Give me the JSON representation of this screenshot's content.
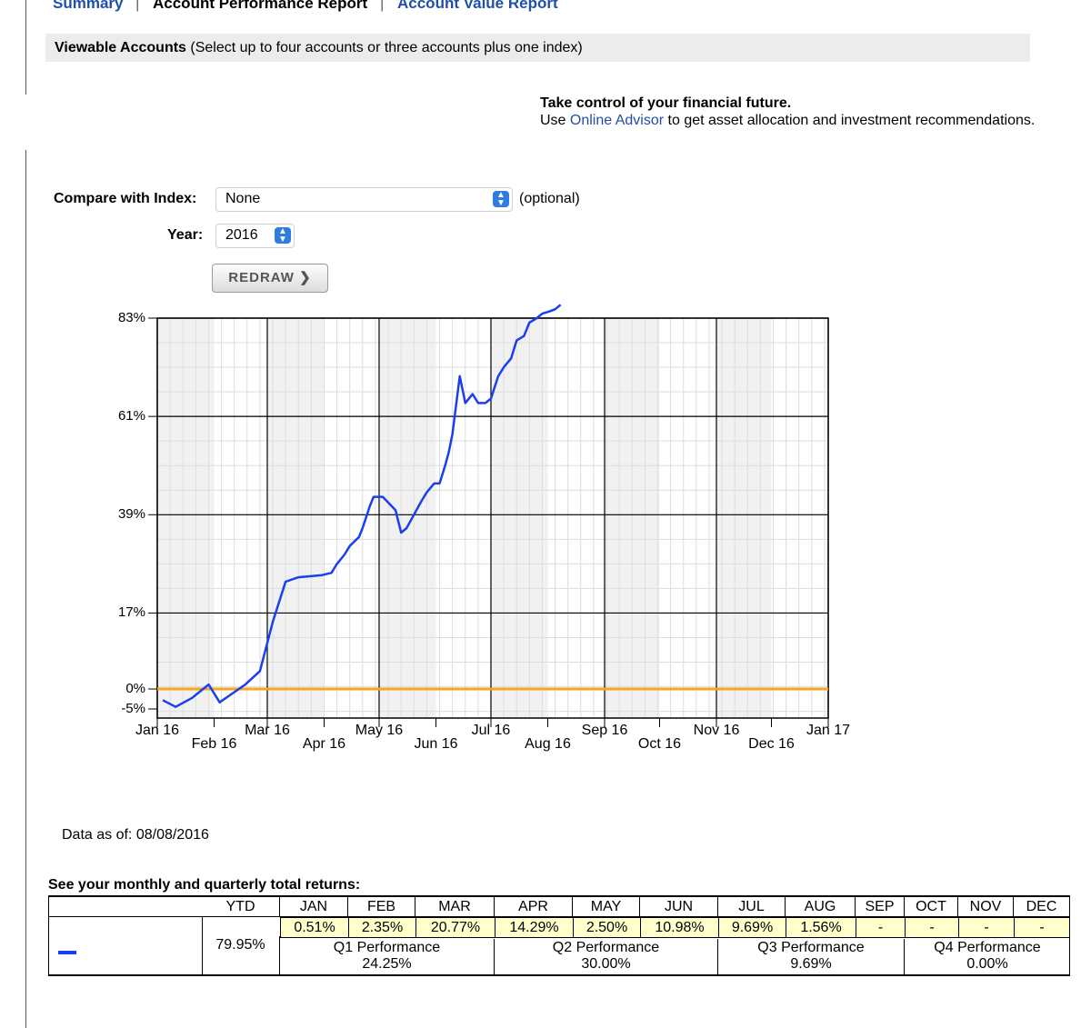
{
  "nav": {
    "summary": "Summary",
    "sep1": "|",
    "performance": "Account Performance Report",
    "sep2": "|",
    "value": "Account Value Report"
  },
  "viewable": {
    "title": "Viewable Accounts",
    "note": "(Select up to four accounts or three accounts plus one index)"
  },
  "promo": {
    "headline": "Take control of your financial future.",
    "pre": "Use ",
    "link": "Online Advisor",
    "post": " to get asset allocation and investment recommendations."
  },
  "form": {
    "index_label": "Compare with Index:",
    "index_value": "None",
    "optional": "(optional)",
    "year_label": "Year:",
    "year_value": "2016",
    "redraw": "REDRAW ❯"
  },
  "chart_data": {
    "type": "line",
    "y_ticks": [
      "83%",
      "61%",
      "39%",
      "17%",
      "0%",
      "-5%"
    ],
    "x_ticks_top": [
      "Jan 16",
      "Mar 16",
      "May 16",
      "Jul 16",
      "Sep 16",
      "Nov 16",
      "Jan 17"
    ],
    "x_ticks_bottom": [
      "Feb 16",
      "Apr 16",
      "Jun 16",
      "Aug 16",
      "Oct 16",
      "Dec 16"
    ],
    "ylim": [
      -5,
      83
    ],
    "xlim": [
      "2016-01-01",
      "2017-01-01"
    ],
    "grid": true,
    "reference_line": {
      "value": 0,
      "color": "#f5a623"
    },
    "series": [
      {
        "color": "#1a3ff0",
        "x": [
          "2016-01-04",
          "2016-01-11",
          "2016-01-20",
          "2016-01-29",
          "2016-02-04",
          "2016-02-11",
          "2016-02-18",
          "2016-02-26",
          "2016-03-04",
          "2016-03-11",
          "2016-03-18",
          "2016-03-31",
          "2016-04-05",
          "2016-04-08",
          "2016-04-12",
          "2016-04-15",
          "2016-04-20",
          "2016-04-22",
          "2016-04-26",
          "2016-04-28",
          "2016-05-03",
          "2016-05-10",
          "2016-05-13",
          "2016-05-16",
          "2016-05-20",
          "2016-05-24",
          "2016-05-27",
          "2016-05-31",
          "2016-06-03",
          "2016-06-06",
          "2016-06-08",
          "2016-06-10",
          "2016-06-14",
          "2016-06-17",
          "2016-06-21",
          "2016-06-24",
          "2016-06-28",
          "2016-07-01",
          "2016-07-05",
          "2016-07-08",
          "2016-07-12",
          "2016-07-15",
          "2016-07-19",
          "2016-07-22",
          "2016-07-26",
          "2016-07-29",
          "2016-08-02",
          "2016-08-05",
          "2016-08-08"
        ],
        "y": [
          -2.5,
          -4,
          -2,
          1,
          -3,
          -1,
          1,
          4,
          15,
          24,
          25,
          25.5,
          26,
          28,
          30,
          32,
          34,
          36,
          41,
          43,
          43,
          40,
          35,
          36,
          39,
          42,
          44,
          46,
          46,
          50,
          53,
          57,
          70,
          64,
          66,
          64,
          64,
          65,
          70,
          72,
          74,
          78,
          79,
          82,
          83,
          84,
          84.5,
          85,
          86
        ]
      }
    ]
  },
  "as_of": "Data as of: 08/08/2016",
  "returns": {
    "title": "See your monthly and quarterly total returns:",
    "ytd_header": "YTD",
    "months": [
      "JAN",
      "FEB",
      "MAR",
      "APR",
      "MAY",
      "JUN",
      "JUL",
      "AUG",
      "SEP",
      "OCT",
      "NOV",
      "DEC"
    ],
    "values": [
      "0.51%",
      "2.35%",
      "20.77%",
      "14.29%",
      "2.50%",
      "10.98%",
      "9.69%",
      "1.56%",
      "-",
      "-",
      "-",
      "-"
    ],
    "ytd": "79.95%",
    "quarters": [
      {
        "label": "Q1 Performance",
        "value": "24.25%"
      },
      {
        "label": "Q2 Performance",
        "value": "30.00%"
      },
      {
        "label": "Q3 Performance",
        "value": "9.69%"
      },
      {
        "label": "Q4 Performance",
        "value": "0.00%"
      }
    ],
    "legend_color": "#1a3ff0"
  }
}
